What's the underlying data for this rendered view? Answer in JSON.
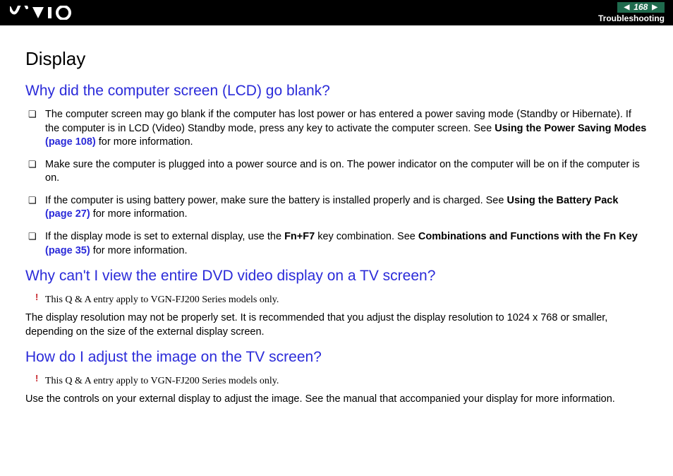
{
  "header": {
    "page_number": "168",
    "section": "Troubleshooting"
  },
  "title": "Display",
  "q1": {
    "heading": "Why did the computer screen (LCD) go blank?",
    "b1_a": "The computer screen may go blank if the computer has lost power or has entered a power saving mode (Standby or Hibernate). If the computer is in LCD (Video) Standby mode, press any key to activate the computer screen. See ",
    "b1_bold": "Using the Power Saving Modes ",
    "b1_link": "(page 108)",
    "b1_c": " for more information.",
    "b2": "Make sure the computer is plugged into a power source and is on. The power indicator on the computer will be on if the computer is on.",
    "b3_a": "If the computer is using battery power, make sure the battery is installed properly and is charged. See ",
    "b3_bold": "Using the Battery Pack ",
    "b3_link": "(page 27)",
    "b3_c": " for more information.",
    "b4_a": "If the display mode is set to external display, use the ",
    "b4_key": "Fn+F7",
    "b4_b": " key combination. See ",
    "b4_bold": "Combinations and Functions with the Fn Key ",
    "b4_link": "(page 35)",
    "b4_c": " for more information."
  },
  "q2": {
    "heading": "Why can't I view the entire DVD video display on a TV screen?",
    "note": "This Q & A entry apply to VGN-FJ200 Series models only.",
    "body": "The display resolution may not be properly set. It is recommended that you adjust the display resolution to 1024 x 768 or smaller, depending on the size of the external display screen."
  },
  "q3": {
    "heading": "How do I adjust the image on the TV screen?",
    "note": "This Q & A entry apply to VGN-FJ200 Series models only.",
    "body": "Use the controls on your external display to adjust the image. See the manual that accompanied your display for more information."
  }
}
